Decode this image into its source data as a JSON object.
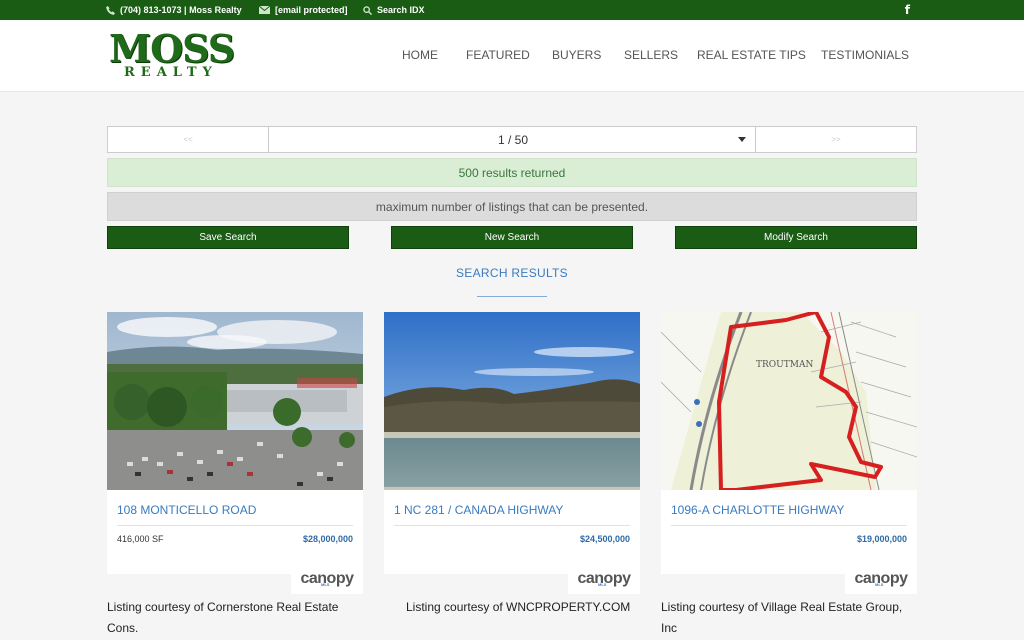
{
  "topbar": {
    "phone": "(704) 813-1073 | Moss Realty",
    "email": "[email protected]",
    "search": "Search IDX",
    "phone_icon": "phone-icon",
    "email_icon": "envelope-icon",
    "search_icon": "search-icon",
    "social_icon": "facebook-icon",
    "social_label": "f"
  },
  "logo": {
    "line1": "MOSS",
    "line2": "REALTY"
  },
  "nav": [
    "HOME",
    "FEATURED",
    "BUYERS",
    "SELLERS",
    "REAL ESTATE TIPS",
    "TESTIMONIALS"
  ],
  "pager": {
    "prev": "<<",
    "current": "1 / 50",
    "next": ">>"
  },
  "alerts": {
    "results": "500 results returned",
    "max": "maximum number of listings that can be presented."
  },
  "buttons": {
    "save": "Save Search",
    "new": "New Search",
    "modify": "Modify Search"
  },
  "results_title": "SEARCH RESULTS",
  "mls_label": "canopy",
  "mls_sub": "MLS",
  "listings": [
    {
      "address": "108 MONTICELLO ROAD",
      "size": "416,000 SF",
      "price": "$28,000,000",
      "courtesy": "Listing courtesy of Cornerstone Real Estate Cons."
    },
    {
      "address": "1 NC 281 / CANADA HIGHWAY",
      "size": "",
      "price": "$24,500,000",
      "courtesy": "Listing courtesy of WNCPROPERTY.COM"
    },
    {
      "address": "1096-A CHARLOTTE HIGHWAY",
      "size": "",
      "price": "$19,000,000",
      "courtesy": "Listing courtesy of Village Real Estate Group, Inc"
    }
  ],
  "map_label": "TROUTMAN",
  "colors": {
    "brand_green": "#1a5c14",
    "link_blue": "#3a7bbf",
    "success_bg": "#d9eed5"
  }
}
